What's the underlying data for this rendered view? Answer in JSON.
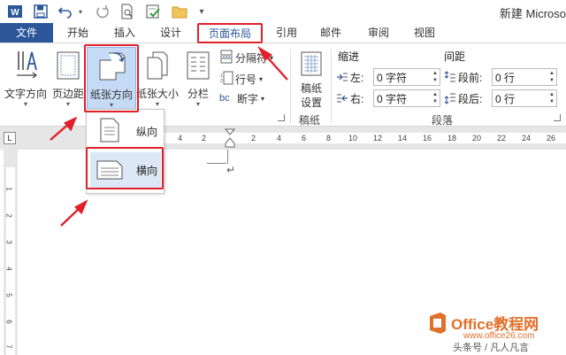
{
  "window": {
    "title": "新建 Microso"
  },
  "qat": {
    "icons": [
      "word-app-icon",
      "save-icon",
      "undo-icon",
      "redo-icon",
      "print-preview-icon",
      "check-icon",
      "folder-icon",
      "more-icon"
    ]
  },
  "tabs": {
    "file": "文件",
    "items": [
      "开始",
      "插入",
      "设计",
      "页面布局",
      "引用",
      "邮件",
      "审阅",
      "视图"
    ],
    "active": "页面布局"
  },
  "ribbon": {
    "text_direction": "文字方向",
    "margins": "页边距",
    "orientation": "纸张方向",
    "size": "纸张大小",
    "columns": "分栏",
    "breaks": "分隔符",
    "line_numbers": "行号",
    "hyphenation": "断字",
    "paper_setup_l1": "稿纸",
    "paper_setup_l2": "设置",
    "paper_group": "稿纸",
    "indent_header": "缩进",
    "spacing_header": "间距",
    "indent_left_label": "左:",
    "indent_right_label": "右:",
    "indent_left_value": "0 字符",
    "indent_right_value": "0 字符",
    "spacing_before_label": "段前:",
    "spacing_after_label": "段后:",
    "spacing_before_value": "0 行",
    "spacing_after_value": "0 行",
    "paragraph_group": "段落",
    "hyph_icon_text": "bc"
  },
  "ruler": {
    "tab_glyph": "L",
    "ticks": [
      "6",
      "4",
      "2",
      "2",
      "4",
      "6",
      "8",
      "10",
      "12",
      "14",
      "16",
      "18",
      "20",
      "22",
      "24",
      "26"
    ],
    "vticks": [
      "1",
      "2",
      "3",
      "4",
      "5",
      "6",
      "7"
    ]
  },
  "dropdown": {
    "portrait": "纵向",
    "landscape": "横向"
  },
  "watermark": {
    "brand": "Office教程网",
    "url": "www.office26.com",
    "author": "头条号 / 凡人凡言"
  },
  "colors": {
    "accent": "#2b579a",
    "highlight": "#e0202a",
    "watermark": "#e0702a"
  }
}
